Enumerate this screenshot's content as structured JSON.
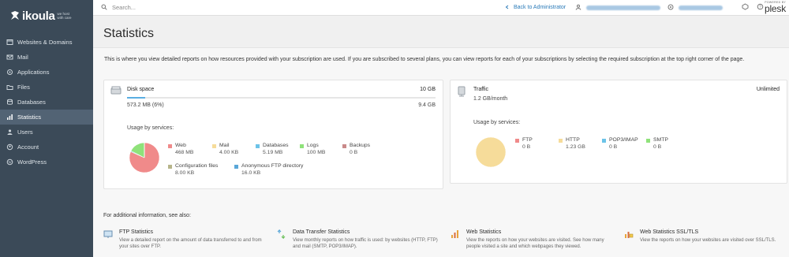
{
  "brand": {
    "name": "ikoula",
    "tagline": "we host with care"
  },
  "sidebar": {
    "items": [
      {
        "label": "Websites & Domains",
        "icon": "globe-icon"
      },
      {
        "label": "Mail",
        "icon": "mail-icon"
      },
      {
        "label": "Applications",
        "icon": "applications-icon"
      },
      {
        "label": "Files",
        "icon": "folder-icon"
      },
      {
        "label": "Databases",
        "icon": "database-icon"
      },
      {
        "label": "Statistics",
        "icon": "bar-chart-icon",
        "active": true
      },
      {
        "label": "Users",
        "icon": "user-icon"
      },
      {
        "label": "Account",
        "icon": "account-icon"
      },
      {
        "label": "WordPress",
        "icon": "wordpress-icon"
      }
    ],
    "collapse_glyph": "‹"
  },
  "topbar": {
    "search_placeholder": "Search...",
    "back_label": "Back to Administrator",
    "plesk_powered": "POWERED BY",
    "plesk_name": "plesk"
  },
  "page": {
    "title": "Statistics",
    "intro": "This is where you view detailed reports on how resources provided with your subscription are used. If you are subscribed to several plans, you can view reports for each of your subscriptions by selecting the required subscription at the top right corner of the page."
  },
  "disk": {
    "title": "Disk space",
    "limit": "10 GB",
    "used": "573.2 MB (6%)",
    "free": "9.4 GB",
    "used_fraction": 0.06,
    "usage_label": "Usage by services:",
    "services": [
      {
        "name": "Web",
        "value": "468 MB",
        "color": "#f08a8a",
        "mb": 468
      },
      {
        "name": "Mail",
        "value": "4.00 KB",
        "color": "#f6dc9a",
        "mb": 0.004
      },
      {
        "name": "Databases",
        "value": "5.19 MB",
        "color": "#6cc3e8",
        "mb": 5.19
      },
      {
        "name": "Logs",
        "value": "100 MB",
        "color": "#8fe27a",
        "mb": 100
      },
      {
        "name": "Backups",
        "value": "0 B",
        "color": "#c98a8a",
        "mb": 0
      },
      {
        "name": "Configuration files",
        "value": "8.00 KB",
        "color": "#b7b58a",
        "mb": 0.008
      },
      {
        "name": "Anonymous FTP directory",
        "value": "16.0 KB",
        "color": "#5aa7d8",
        "mb": 0.016
      }
    ]
  },
  "traffic": {
    "title": "Traffic",
    "limit": "Unlimited",
    "used": "1.2 GB/month",
    "usage_label": "Usage by services:",
    "services": [
      {
        "name": "FTP",
        "value": "0 B",
        "color": "#f08a8a",
        "gb": 0
      },
      {
        "name": "HTTP",
        "value": "1.23 GB",
        "color": "#f6dc9a",
        "gb": 1.23
      },
      {
        "name": "POP3/IMAP",
        "value": "0 B",
        "color": "#6cc3e8",
        "gb": 0
      },
      {
        "name": "SMTP",
        "value": "0 B",
        "color": "#8fe27a",
        "gb": 0
      }
    ]
  },
  "additional": {
    "label": "For additional information, see also:",
    "links": [
      {
        "title": "FTP Statistics",
        "desc": "View a detailed report on the amount of data transferred to and from your sites over FTP.",
        "icon": "ftp-statistics-icon"
      },
      {
        "title": "Data Transfer Statistics",
        "desc": "View monthly reports on how traffic is used: by websites (HTTP, FTP) and mail (SMTP, POP3/IMAP).",
        "icon": "data-transfer-icon"
      },
      {
        "title": "Web Statistics",
        "desc": "View the reports on how your websites are visited. See how many people visited a site and which webpages they viewed.",
        "icon": "web-statistics-icon"
      },
      {
        "title": "Web Statistics SSL/TLS",
        "desc": "View the reports on how your websites are visited over SSL/TLS.",
        "icon": "web-statistics-ssl-icon"
      }
    ]
  }
}
